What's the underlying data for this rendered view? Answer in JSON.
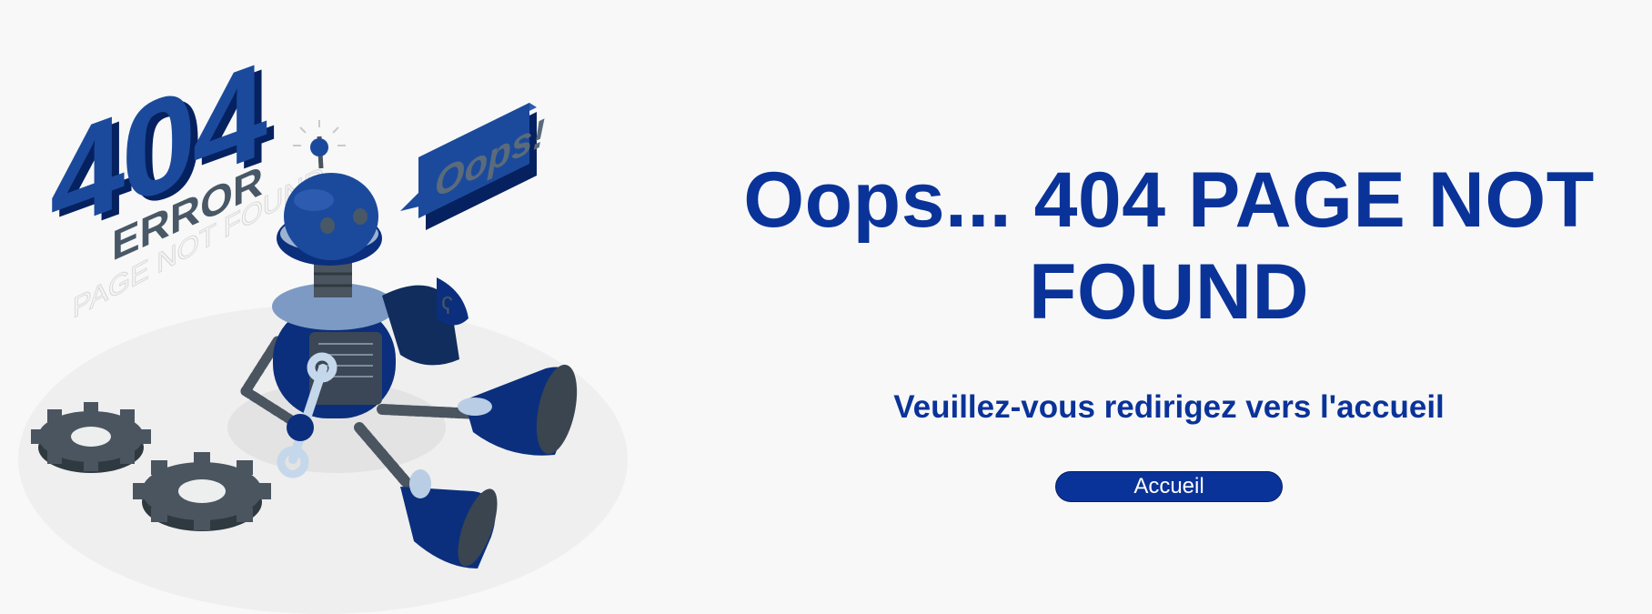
{
  "illustration": {
    "big_number": "404",
    "error_word": "ERROR",
    "sub_caption": "PAGE NOT FOUND",
    "bubble_text": "Oops!"
  },
  "main": {
    "headline": "Oops... 404 PAGE NOT FOUND",
    "subline": "Veuillez-vous redirigez vers l'accueil",
    "home_button_label": "Accueil"
  },
  "colors": {
    "primary": "#0a3399",
    "background": "#f8f8f8"
  }
}
